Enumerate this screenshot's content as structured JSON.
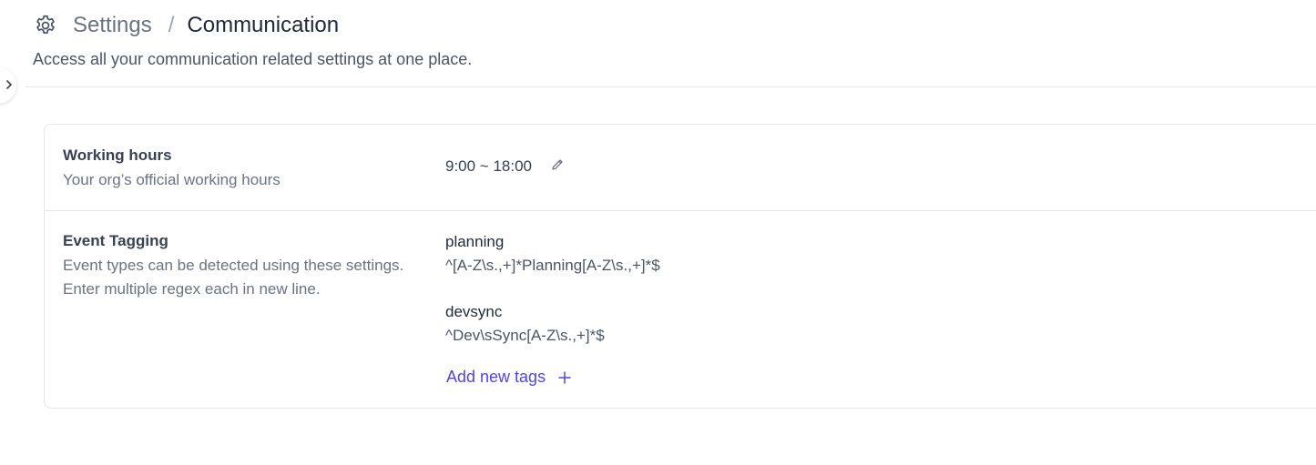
{
  "header": {
    "breadcrumb_root": "Settings",
    "breadcrumb_separator": "/",
    "breadcrumb_current": "Communication",
    "subtitle": "Access all your communication related settings at one place."
  },
  "icons": {
    "settings": "gear-icon",
    "edit": "pencil-icon",
    "add": "plus-icon",
    "collapse": "chevron-right-icon"
  },
  "working_hours": {
    "title": "Working hours",
    "description": "Your org’s official working hours",
    "value": "9:00 ~ 18:00"
  },
  "event_tagging": {
    "title": "Event Tagging",
    "description": "Event types can be detected using these settings. Enter multiple regex each in new line.",
    "tags": [
      {
        "name": "planning",
        "regex": "^[A-Z\\s.,+]*Planning[A-Z\\s.,+]*$"
      },
      {
        "name": "devsync",
        "regex": "^Dev\\sSync[A-Z\\s.,+]*$"
      }
    ],
    "add_label": "Add new tags"
  },
  "colors": {
    "accent": "#4f46e5",
    "border": "#e5e7eb",
    "muted_text": "#6b7280"
  }
}
